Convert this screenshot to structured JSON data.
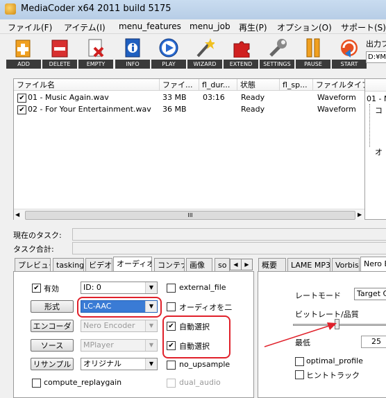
{
  "window": {
    "title": "MediaCoder x64 2011 build 5175"
  },
  "menu": [
    "ファイル(F)",
    "アイテム(I)",
    "menu_features",
    "menu_job",
    "再生(P)",
    "オプション(O)",
    "サポート(S)"
  ],
  "toolbar": [
    {
      "label": "ADD",
      "icon": "add-icon",
      "color": "#f0a020"
    },
    {
      "label": "DELETE",
      "icon": "delete-icon",
      "color": "#d83030"
    },
    {
      "label": "EMPTY",
      "icon": "empty-icon",
      "color": "#c03030"
    },
    {
      "label": "INFO",
      "icon": "info-icon",
      "color": "#2060c0"
    },
    {
      "label": "PLAY",
      "icon": "play-icon",
      "color": "#2a6ad0"
    },
    {
      "label": "WIZARD",
      "icon": "wizard-icon",
      "color": "#606060"
    },
    {
      "label": "EXTEND",
      "icon": "extend-icon",
      "color": "#d02020"
    },
    {
      "label": "SETTINGS",
      "icon": "settings-icon",
      "color": "#707070"
    },
    {
      "label": "PAUSE",
      "icon": "pause-icon",
      "color": "#f0a020"
    },
    {
      "label": "START",
      "icon": "start-icon",
      "color": "#2a7ad0"
    }
  ],
  "output_folder": {
    "label": "出力フ",
    "value": "D:¥M"
  },
  "filelist": {
    "columns": [
      "ファイル名",
      "ファイ...",
      "fl_dur...",
      "状態",
      "fl_sp...",
      "ファイルタイプ"
    ],
    "rows": [
      {
        "checked": true,
        "name": "01 - Music Again.wav",
        "size": "33 MB",
        "duration": "03:16",
        "state": "Ready",
        "speed": "",
        "type": "Waveform"
      },
      {
        "checked": true,
        "name": "02 - For Your Entertainment.wav",
        "size": "36 MB",
        "duration": "",
        "state": "Ready",
        "speed": "",
        "type": "Waveform"
      }
    ],
    "scroll_grip": "III"
  },
  "right_tree": {
    "items": [
      "01 - M",
      "コ",
      "オ"
    ]
  },
  "task": {
    "current_label": "現在のタスク:",
    "total_label": "タスク合計:"
  },
  "left_tabs": [
    "プレビュー",
    "tasking",
    "ビデオ",
    "オーディオ",
    "コンテナ",
    "画像",
    "so"
  ],
  "left_tabs_selected": "オーディオ",
  "audio": {
    "enabled_label": "有効",
    "id_value": "ID: 0",
    "format_button": "形式",
    "format_value": "LC-AAC",
    "encoder_button": "エンコーダ",
    "encoder_value": "Nero Encoder",
    "source_button": "ソース",
    "source_value": "MPlayer",
    "resample_button": "リサンプル",
    "resample_value": "オリジナル",
    "compute_replaygain": "compute_replaygain",
    "external_file": "external_file",
    "audio_only": "オーディオを二",
    "auto_select_1": "自動選択",
    "auto_select_2": "自動選択",
    "no_upsample": "no_upsample",
    "dual_audio": "dual_audio"
  },
  "right_tabs": [
    "概要",
    "LAME MP3",
    "Vorbis",
    "Nero E"
  ],
  "right_tabs_selected": "Nero E",
  "nero": {
    "rate_mode_label": "レートモード",
    "rate_mode_value": "Target Q",
    "bitrate_label": "ビットレート/品質",
    "min_label": "最低",
    "min_value": "25",
    "optimal_profile": "optimal_profile",
    "hint_track": "ヒントトラック"
  }
}
